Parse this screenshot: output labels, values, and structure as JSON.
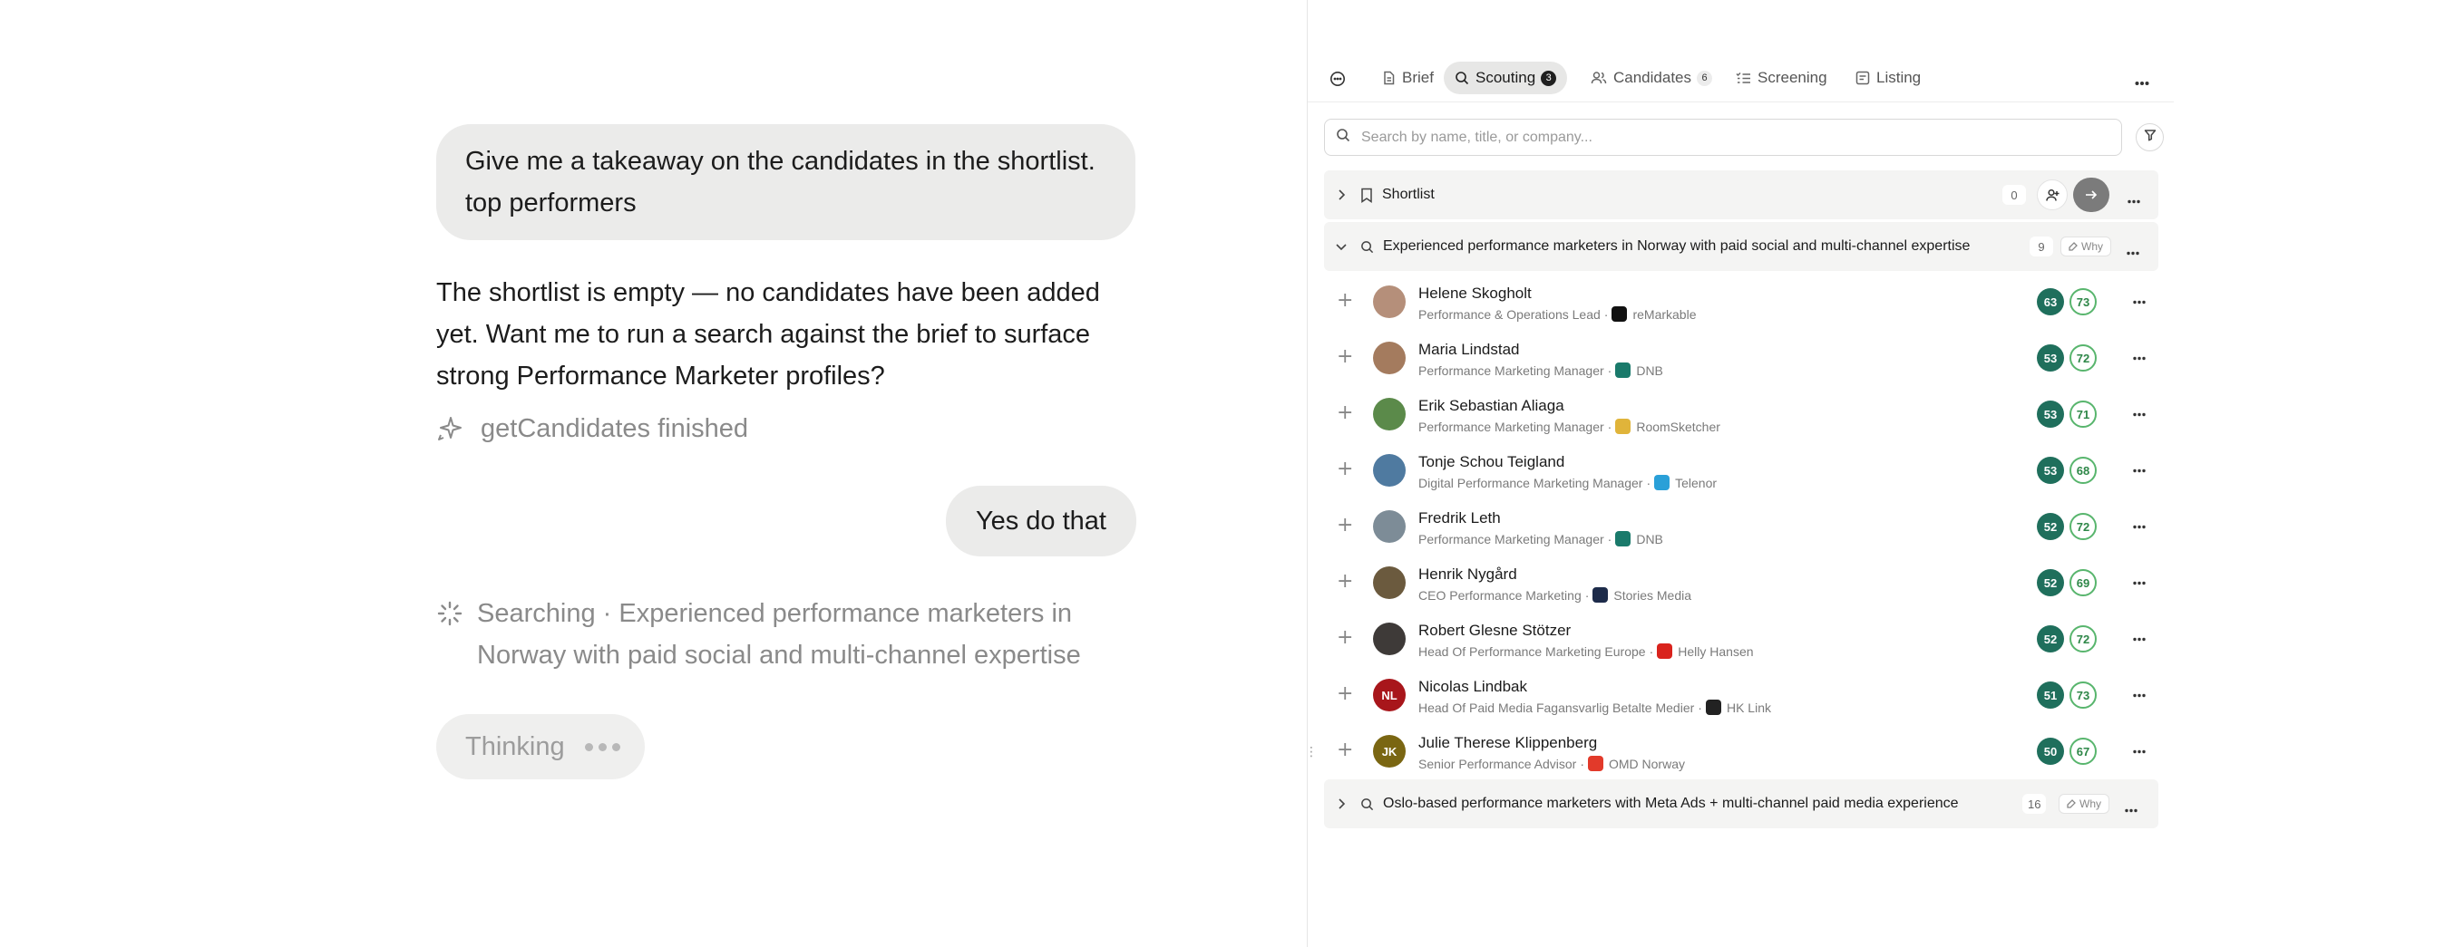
{
  "chat": {
    "user_message_1": "Give me a takeaway on the candidates in the shortlist. top performers",
    "assistant_message": "The shortlist is empty — no candidates have been added yet. Want me to run a search against the brief to surface strong Performance Marketer profiles?",
    "tool_finished": "getCandidates finished",
    "user_message_2": "Yes do that",
    "tool_running": "Searching · Experienced performance marketers in Norway with paid social and multi-channel expertise",
    "thinking_label": "Thinking"
  },
  "tabs": {
    "brief": "Brief",
    "scouting": "Scouting",
    "scouting_count": "3",
    "candidates": "Candidates",
    "candidates_count": "6",
    "screening": "Screening",
    "listing": "Listing"
  },
  "search": {
    "placeholder": "Search by name, title, or company..."
  },
  "groups": {
    "shortlist": {
      "label": "Shortlist",
      "count": "0"
    },
    "experienced": {
      "label": "Experienced performance marketers in Norway with paid social and multi-channel expertise",
      "count": "9",
      "why": "Why"
    },
    "oslo": {
      "label": "Oslo-based performance marketers with Meta Ads + multi-channel paid media experience",
      "count": "16",
      "why": "Why"
    }
  },
  "candidates": [
    {
      "name": "Helene Skogholt",
      "title": "Performance & Operations Lead",
      "company": "reMarkable",
      "score_a": "63",
      "score_b": "73",
      "avatar_initials": "",
      "avatar_color": "#b58f7a",
      "logo_color": "#111111"
    },
    {
      "name": "Maria Lindstad",
      "title": "Performance Marketing Manager",
      "company": "DNB",
      "score_a": "53",
      "score_b": "72",
      "avatar_initials": "",
      "avatar_color": "#a47b5e",
      "logo_color": "#1a7a6b"
    },
    {
      "name": "Erik Sebastian Aliaga",
      "title": "Performance Marketing Manager",
      "company": "RoomSketcher",
      "score_a": "53",
      "score_b": "71",
      "avatar_initials": "",
      "avatar_color": "#5b8a4a",
      "logo_color": "#e0b43a"
    },
    {
      "name": "Tonje Schou Teigland",
      "title": "Digital Performance Marketing Manager",
      "company": "Telenor",
      "score_a": "53",
      "score_b": "68",
      "avatar_initials": "",
      "avatar_color": "#4f7aa0",
      "logo_color": "#2aa0d8"
    },
    {
      "name": "Fredrik Leth",
      "title": "Performance Marketing Manager",
      "company": "DNB",
      "score_a": "52",
      "score_b": "72",
      "avatar_initials": "",
      "avatar_color": "#7d8c97",
      "logo_color": "#1a7a6b"
    },
    {
      "name": "Henrik Nygård",
      "title": "CEO Performance Marketing",
      "company": "Stories Media",
      "score_a": "52",
      "score_b": "69",
      "avatar_initials": "",
      "avatar_color": "#6b5a3e",
      "logo_color": "#1d2b4a"
    },
    {
      "name": "Robert Glesne Stötzer",
      "title": "Head Of Performance Marketing Europe",
      "company": "Helly Hansen",
      "score_a": "52",
      "score_b": "72",
      "avatar_initials": "",
      "avatar_color": "#3e3a38",
      "logo_color": "#d9231d"
    },
    {
      "name": "Nicolas Lindbak",
      "title": "Head Of Paid Media Fagansvarlig Betalte Medier",
      "company": "HK Link",
      "score_a": "51",
      "score_b": "73",
      "avatar_initials": "NL",
      "avatar_color": "#a8161b",
      "logo_color": "#222222"
    },
    {
      "name": "Julie Therese Klippenberg",
      "title": "Senior Performance Advisor",
      "company": "OMD Norway",
      "score_a": "50",
      "score_b": "67",
      "avatar_initials": "JK",
      "avatar_color": "#7a6612",
      "logo_color": "#e23a2a"
    }
  ],
  "colors": {
    "score_fill": "#1f6f5c",
    "score_ring": "#58b56d",
    "accent_gray": "#7a7a7a"
  }
}
